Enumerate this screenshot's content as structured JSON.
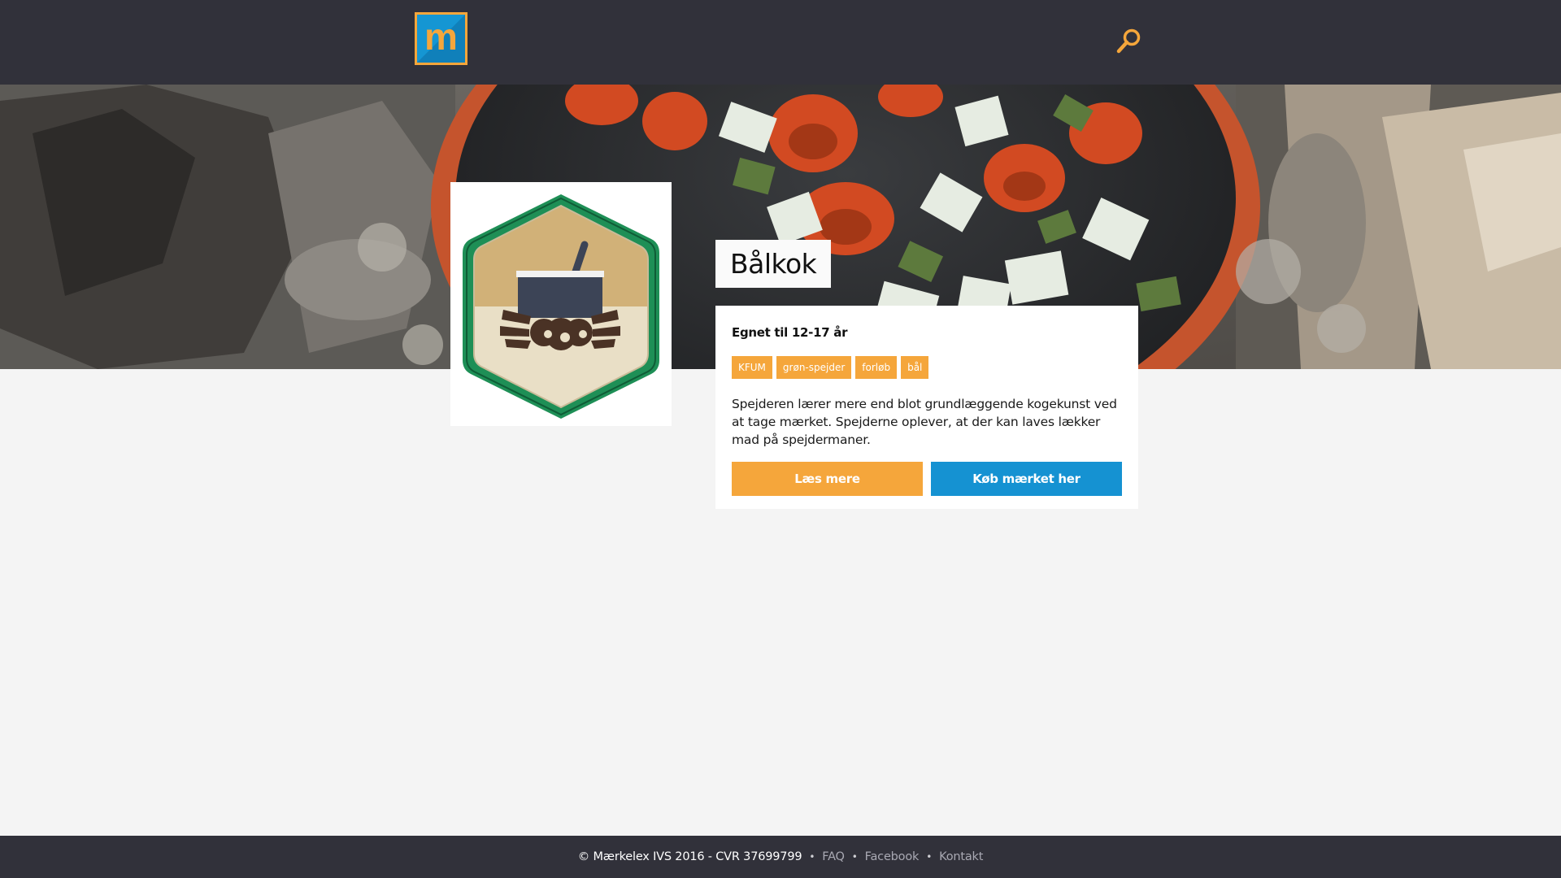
{
  "header": {
    "logo_letter": "m",
    "search_icon": "search-icon"
  },
  "badge": {
    "image": "badge-image",
    "title": "Bålkok",
    "age": "Egnet til 12-17 år",
    "tags": [
      "KFUM",
      "grøn-spejder",
      "forløb",
      "bål"
    ],
    "description": "Spejderen lærer mere end blot grundlæggende kogekunst ved at tage mærket. Spejderne oplever, at der kan laves lækker mad på spejdermaner.",
    "read_more_label": "Læs mere",
    "buy_label": "Køb mærket her"
  },
  "footer": {
    "copyright": "© Mærkelex IVS 2016 - CVR 37699799",
    "links": [
      "FAQ",
      "Facebook",
      "Kontakt"
    ]
  },
  "colors": {
    "accent_orange": "#f5a63b",
    "accent_blue": "#1592d2",
    "bar_dark": "#31313a"
  }
}
